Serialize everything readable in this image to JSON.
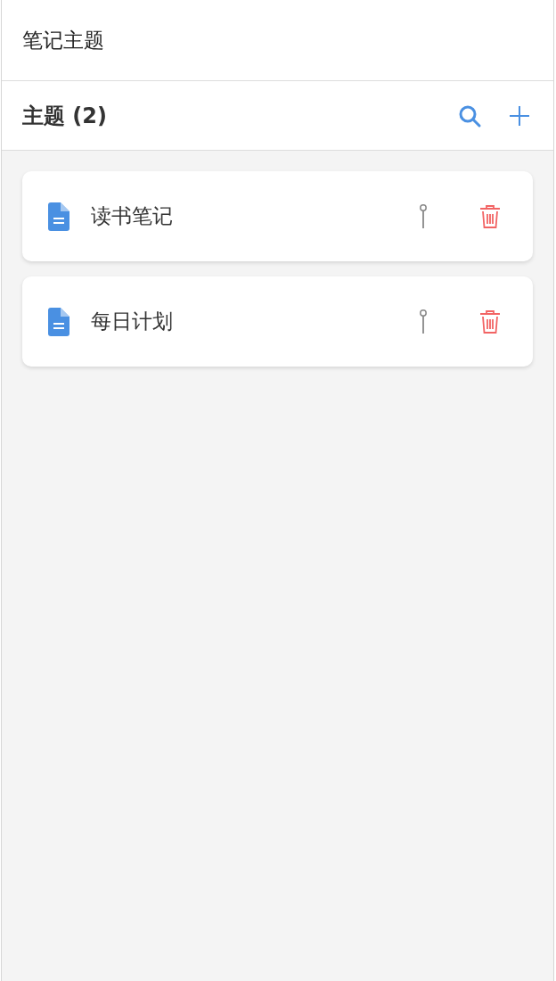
{
  "header": {
    "title": "笔记主题"
  },
  "toolbar": {
    "title": "主题 (2)"
  },
  "topics": [
    {
      "name": "读书笔记",
      "pinned": false
    },
    {
      "name": "每日计划",
      "pinned": false
    }
  ]
}
